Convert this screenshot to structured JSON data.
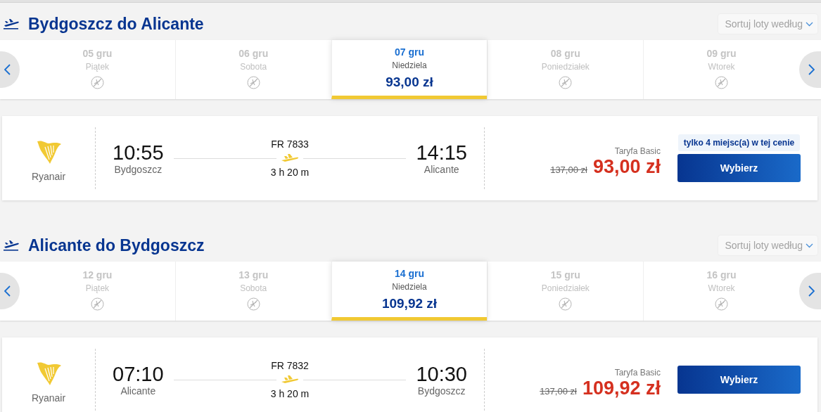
{
  "sections": [
    {
      "title": "Bydgoszcz do Alicante",
      "sort": {
        "placeholder": "Sortuj loty według"
      },
      "dates": [
        {
          "date": "05 gru",
          "day": "Piątek",
          "selected": false
        },
        {
          "date": "06 gru",
          "day": "Sobota",
          "selected": false
        },
        {
          "date": "07 gru",
          "day": "Niedziela",
          "price": "93,00 zł",
          "selected": true
        },
        {
          "date": "08 gru",
          "day": "Poniedziałek",
          "selected": false
        },
        {
          "date": "09 gru",
          "day": "Wtorek",
          "selected": false
        }
      ],
      "flight": {
        "airline": "Ryanair",
        "depart_time": "10:55",
        "depart_city": "Bydgoszcz",
        "number": "FR 7833",
        "duration": "3 h 20 m",
        "arrive_time": "14:15",
        "arrive_city": "Alicante",
        "fare": "Taryfa Basic",
        "old_price": "137,00 zł",
        "price": "93,00 zł",
        "badge": "tylko 4 miejsc(a) w tej cenie",
        "button": "Wybierz"
      }
    },
    {
      "title": "Alicante do Bydgoszcz",
      "sort": {
        "placeholder": "Sortuj loty według"
      },
      "dates": [
        {
          "date": "12 gru",
          "day": "Piątek",
          "selected": false
        },
        {
          "date": "13 gru",
          "day": "Sobota",
          "selected": false
        },
        {
          "date": "14 gru",
          "day": "Niedziela",
          "price": "109,92 zł",
          "selected": true
        },
        {
          "date": "15 gru",
          "day": "Poniedziałek",
          "selected": false
        },
        {
          "date": "16 gru",
          "day": "Wtorek",
          "selected": false
        }
      ],
      "flight": {
        "airline": "Ryanair",
        "depart_time": "07:10",
        "depart_city": "Alicante",
        "number": "FR 7832",
        "duration": "3 h 20 m",
        "arrive_time": "10:30",
        "arrive_city": "Bydgoszcz",
        "fare": "Taryfa Basic",
        "old_price": "137,00 zł",
        "price": "109,92 zł",
        "button": "Wybierz"
      }
    }
  ]
}
